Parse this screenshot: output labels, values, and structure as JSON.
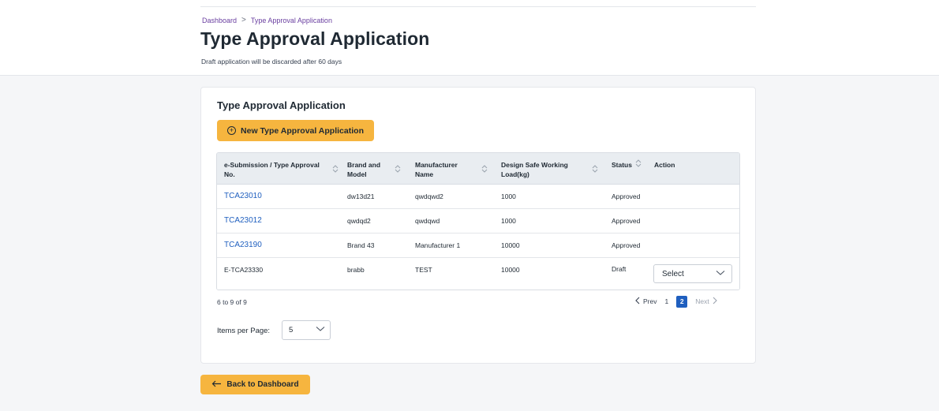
{
  "breadcrumb": {
    "home": "Dashboard",
    "separator": ">",
    "current": "Type Approval Application"
  },
  "page": {
    "title": "Type Approval Application",
    "subtitle": "Draft application will be discarded after 60 days"
  },
  "card": {
    "title": "Type Approval Application",
    "new_button_label": "New Type Approval Application",
    "new_button_icon": "plus-circle-icon"
  },
  "table": {
    "headers": {
      "submission": "e-Submission / Type Approval No.",
      "brand": "Brand and Model",
      "manufacturer": "Manufacturer Name",
      "load": "Design Safe Working Load(kg)",
      "status": "Status",
      "action": "Action"
    },
    "rows": [
      {
        "no": "TCA23010",
        "brand": "dw13d21",
        "manufacturer": "qwdqwd2",
        "load": "1000",
        "status": "Approved",
        "is_link": true
      },
      {
        "no": "TCA23012",
        "brand": "qwdqd2",
        "manufacturer": "qwdqwd",
        "load": "1000",
        "status": "Approved",
        "is_link": true
      },
      {
        "no": "TCA23190",
        "brand": "Brand 43",
        "manufacturer": "Manufacturer 1",
        "load": "10000",
        "status": "Approved",
        "is_link": true
      },
      {
        "no": "E-TCA23330",
        "brand": "brabb",
        "manufacturer": "TEST",
        "load": "10000",
        "status": "Draft",
        "is_link": false,
        "action_select": "Select"
      }
    ]
  },
  "pagination": {
    "range_text": "6 to 9 of 9",
    "prev_label": "Prev",
    "pages": [
      "1",
      "2"
    ],
    "active_page": "2",
    "next_label": "Next"
  },
  "items_per_page": {
    "label": "Items per Page:",
    "value": "5"
  },
  "back_button": {
    "label": "Back to Dashboard",
    "icon": "arrow-left-icon"
  },
  "colors": {
    "accent": "#f6b53f",
    "link": "#1f5fbf",
    "breadcrumb": "#6a3fa0",
    "table_header_bg": "#e9edf1"
  }
}
